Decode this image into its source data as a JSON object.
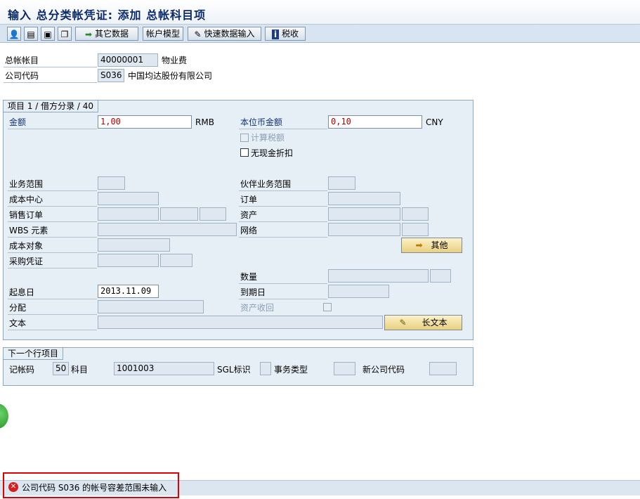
{
  "window": {
    "title": "输入 总分类帐凭证: 添加 总帐科目项"
  },
  "toolbar": {
    "buttons": [
      {
        "label": "其它数据"
      },
      {
        "label": "帐户模型"
      },
      {
        "label": "快速数据输入"
      },
      {
        "label": "税收"
      }
    ]
  },
  "header": {
    "gl_account_label": "总帐帐目",
    "gl_account_value": "40000001",
    "gl_account_text": "物业费",
    "company_code_label": "公司代码",
    "company_code_value": "S036",
    "company_code_text": "中国均达股份有限公司"
  },
  "item": {
    "group_title": "项目 1 / 借方分录 / 40",
    "amount_label": "金额",
    "amount_value": "1,00",
    "amount_currency": "RMB",
    "local_amount_label": "本位币金额",
    "local_amount_value": "0,10",
    "local_currency": "CNY",
    "calc_tax_label": "计算税额",
    "no_cash_discount_label": "无现金折扣",
    "business_area_label": "业务范围",
    "partner_business_area_label": "伙伴业务范围",
    "cost_center_label": "成本中心",
    "order_label": "订单",
    "sales_order_label": "销售订单",
    "asset_label": "资产",
    "wbs_label": "WBS 元素",
    "network_label": "网络",
    "cost_object_label": "成本对象",
    "more_button_label": "其他",
    "purchase_doc_label": "采购凭证",
    "quantity_label": "数量",
    "value_date_label": "起息日",
    "value_date_value": "2013.11.09",
    "due_date_label": "到期日",
    "assignment_label": "分配",
    "asset_retirement_label": "资产收回",
    "text_label": "文本",
    "long_text_button_label": "长文本"
  },
  "next_item": {
    "group_title": "下一个行项目",
    "posting_key_label": "记帐码",
    "posting_key_value": "50",
    "account_label": "科目",
    "account_value": "1001003",
    "sgl_label": "SGL标识",
    "transaction_type_label": "事务类型",
    "new_company_code_label": "新公司代码"
  },
  "status_bar": {
    "message": "公司代码 S036 的帐号容差范围未输入"
  },
  "colors": {
    "accent_title": "#0a2a6a",
    "error_border": "#e00000",
    "value_red": "#b00000"
  }
}
